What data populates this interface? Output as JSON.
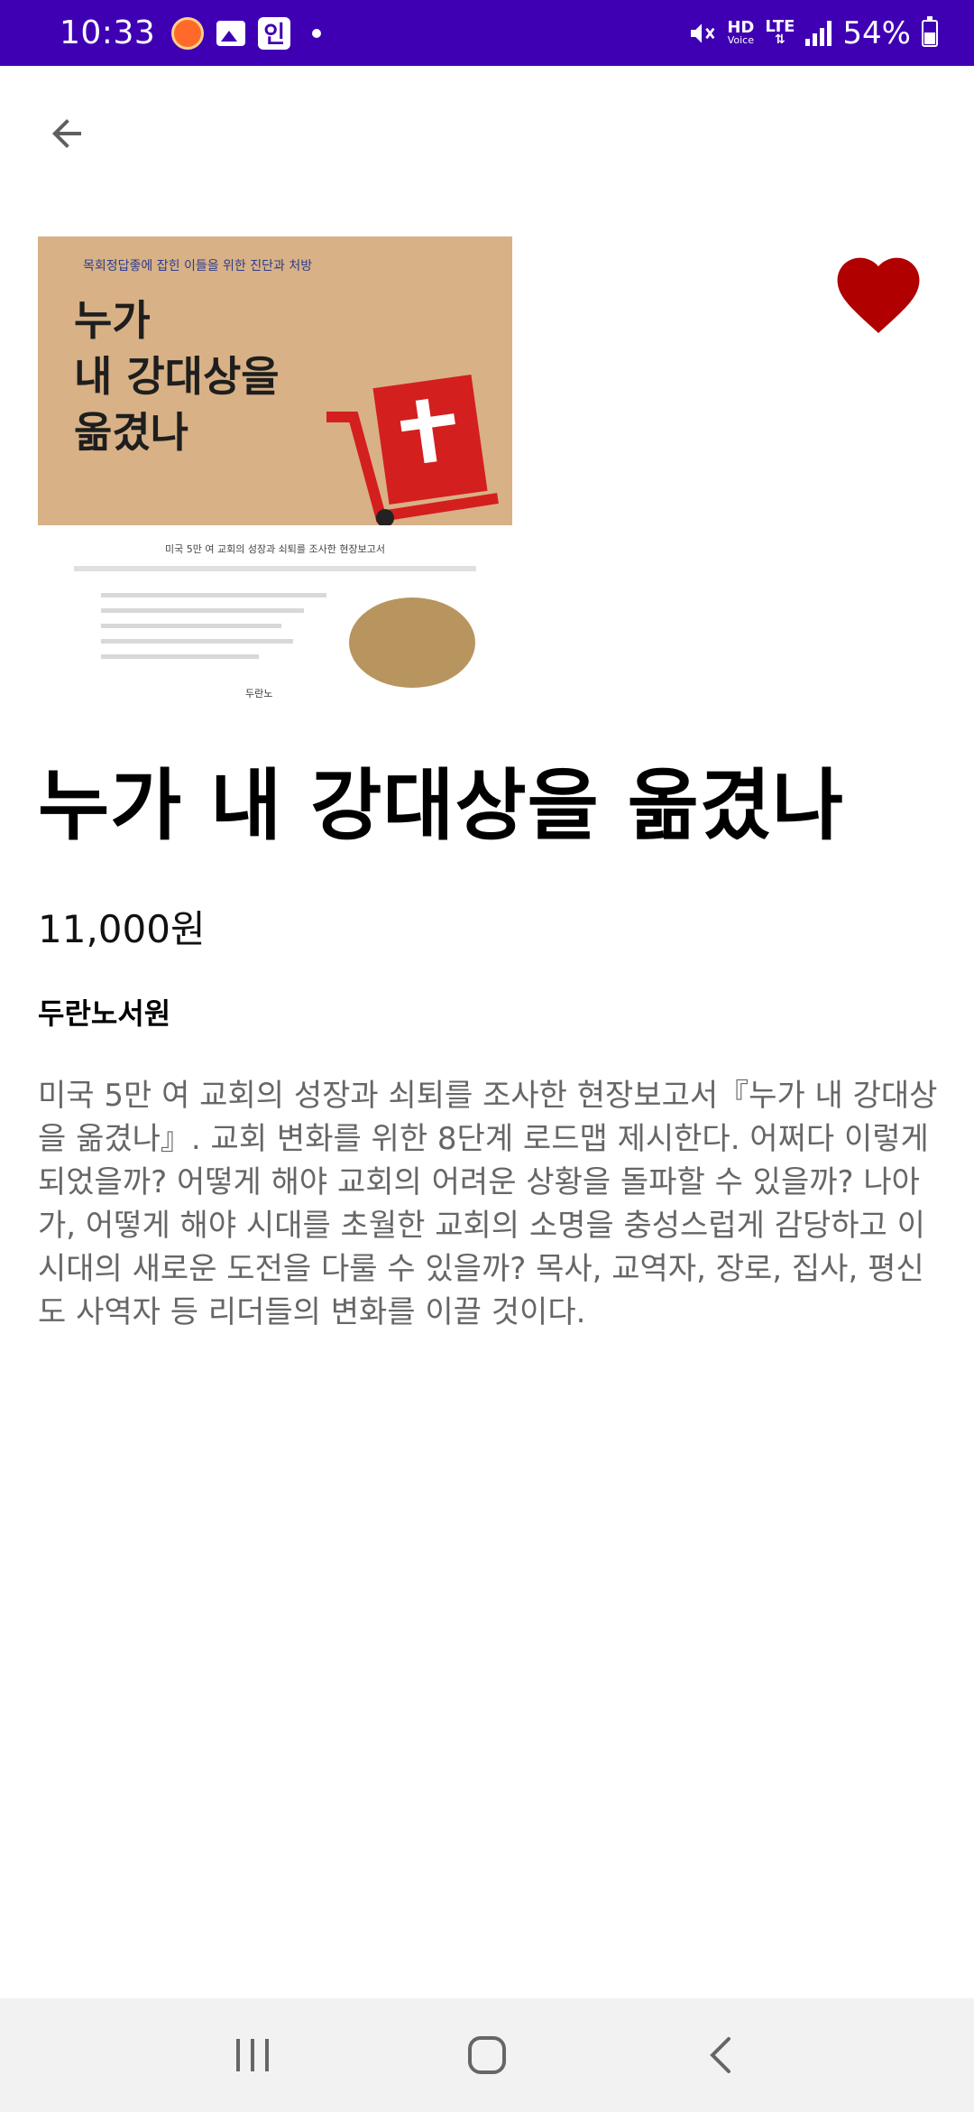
{
  "status_bar": {
    "time": "10:33",
    "notification_kakao": "인",
    "hd": "HD",
    "voice": "Voice",
    "lte": "LTE",
    "battery": "54%"
  },
  "book": {
    "title": "누가 내 강대상을 옮겼나",
    "price": "11,000원",
    "publisher": "두란노서원",
    "description": "미국 5만 여 교회의 성장과 쇠퇴를 조사한 현장보고서『누가 내 강대상을 옮겼나』. 교회 변화를 위한 8단계 로드맵 제시한다. 어쩌다 이렇게 되었을까? 어떻게 해야 교회의 어려운 상황을 돌파할 수 있을까? 나아가, 어떻게 해야 시대를 초월한 교회의 소명을 충성스럽게 감당하고 이 시대의 새로운 도전을 다룰 수 있을까? 목사, 교역자, 장로, 집사, 평신도 사역자 등 리더들의 변화를 이끌 것이다.",
    "favorited": true
  },
  "cover": {
    "tagline": "목회정답좋에 잡힌 이들을 위한 진단과 처방",
    "title_line1": "누가",
    "title_line2": "내 강대상을",
    "title_line3": "옮겼나",
    "subtitle1": "미국 5만 여 교회의 성장과 쇠퇴를 조사한 현장보고서",
    "publisher": "두란노"
  },
  "icons": {
    "back": "arrow-left-icon",
    "favorite": "heart-icon",
    "recents": "recent-apps-icon",
    "home": "home-icon",
    "nav_back": "chevron-left-icon"
  },
  "colors": {
    "status_bar": "#3f00b4",
    "heart": "#b00000",
    "cover_bg": "#d8b186",
    "cart_red": "#d41f1f"
  }
}
